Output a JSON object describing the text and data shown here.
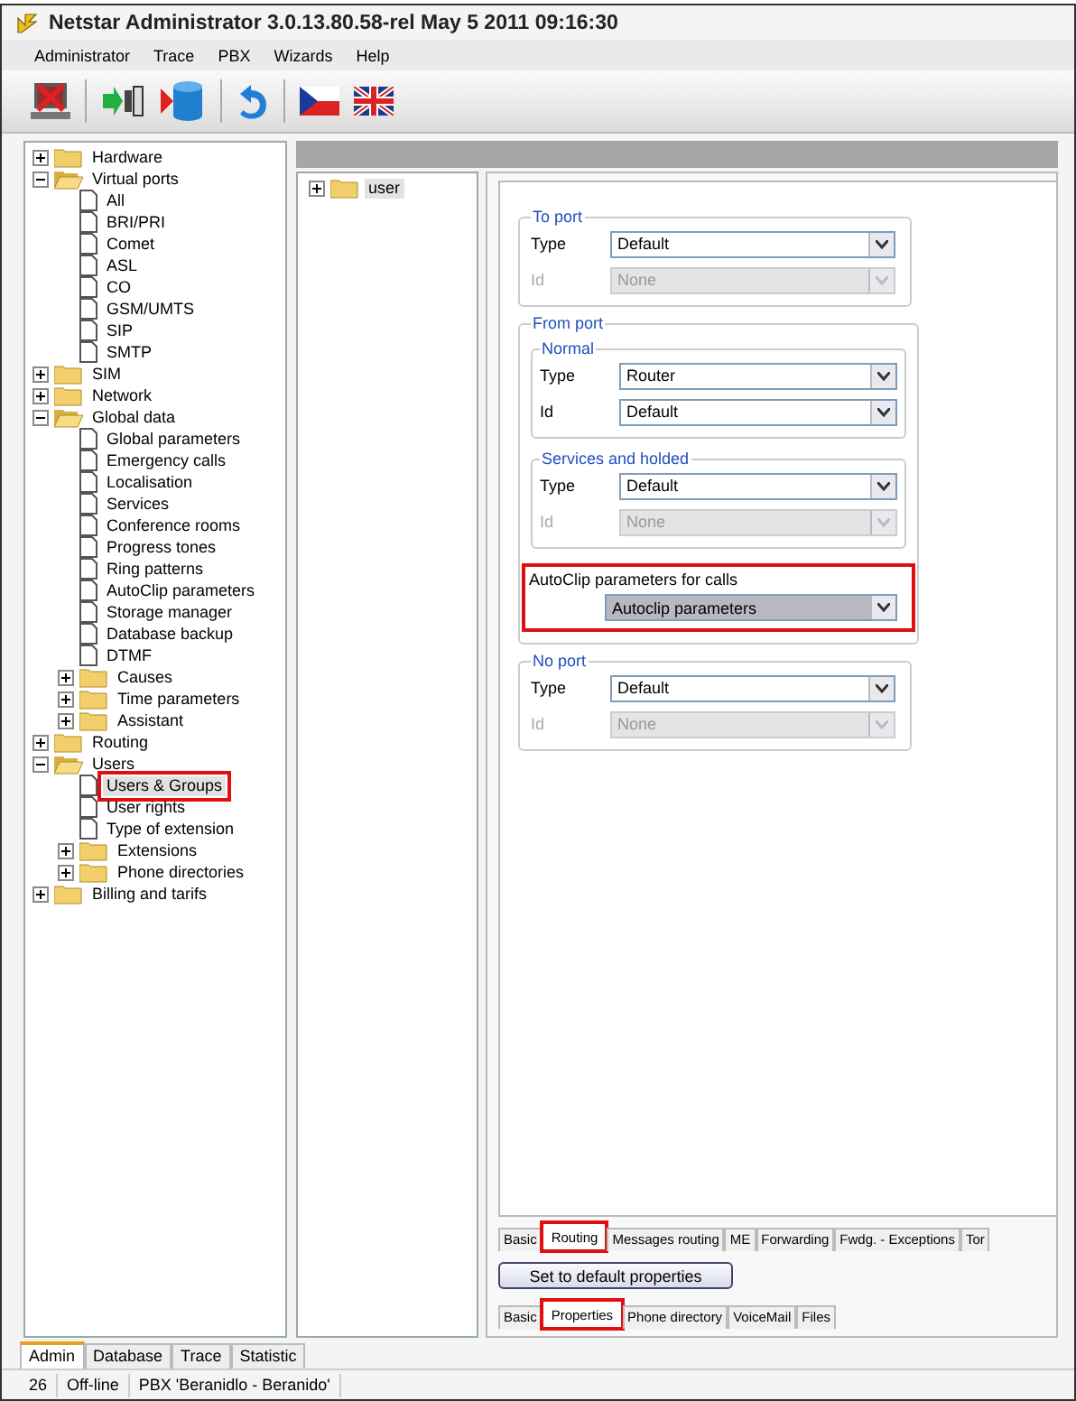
{
  "window": {
    "title": "Netstar Administrator 3.0.13.80.58-rel May  5 2011 09:16:30"
  },
  "menu": [
    "Administrator",
    "Trace",
    "PBX",
    "Wizards",
    "Help"
  ],
  "toolbar": [
    {
      "kind": "disconnect"
    },
    {
      "kind": "connect"
    },
    {
      "kind": "database"
    },
    {
      "kind": "undo"
    },
    {
      "kind": "flag_cz"
    },
    {
      "kind": "flag_uk"
    }
  ],
  "tree": [
    {
      "label": "Hardware",
      "kind": "folder",
      "expanded": false,
      "selected": false,
      "highlighted": false
    },
    {
      "label": "Virtual ports",
      "kind": "folder",
      "expanded": true,
      "selected": false,
      "highlighted": false,
      "children": [
        {
          "label": "All",
          "kind": "page",
          "selected": false,
          "highlighted": false
        },
        {
          "label": "BRI/PRI",
          "kind": "page",
          "selected": false,
          "highlighted": false
        },
        {
          "label": "Comet",
          "kind": "page",
          "selected": false,
          "highlighted": false
        },
        {
          "label": "ASL",
          "kind": "page",
          "selected": false,
          "highlighted": false
        },
        {
          "label": "CO",
          "kind": "page",
          "selected": false,
          "highlighted": false
        },
        {
          "label": "GSM/UMTS",
          "kind": "page",
          "selected": false,
          "highlighted": false
        },
        {
          "label": "SIP",
          "kind": "page",
          "selected": false,
          "highlighted": false
        },
        {
          "label": "SMTP",
          "kind": "page",
          "selected": false,
          "highlighted": false
        }
      ]
    },
    {
      "label": "SIM",
      "kind": "folder",
      "expanded": false,
      "selected": false,
      "highlighted": false
    },
    {
      "label": "Network",
      "kind": "folder",
      "expanded": false,
      "selected": false,
      "highlighted": false
    },
    {
      "label": "Global data",
      "kind": "folder",
      "expanded": true,
      "selected": false,
      "highlighted": false,
      "children": [
        {
          "label": "Global parameters",
          "kind": "page",
          "selected": false,
          "highlighted": false
        },
        {
          "label": "Emergency calls",
          "kind": "page",
          "selected": false,
          "highlighted": false
        },
        {
          "label": "Localisation",
          "kind": "page",
          "selected": false,
          "highlighted": false
        },
        {
          "label": "Services",
          "kind": "page",
          "selected": false,
          "highlighted": false
        },
        {
          "label": "Conference rooms",
          "kind": "page",
          "selected": false,
          "highlighted": false
        },
        {
          "label": "Progress tones",
          "kind": "page",
          "selected": false,
          "highlighted": false
        },
        {
          "label": "Ring patterns",
          "kind": "page",
          "selected": false,
          "highlighted": false
        },
        {
          "label": "AutoClip parameters",
          "kind": "page",
          "selected": false,
          "highlighted": false
        },
        {
          "label": "Storage manager",
          "kind": "page",
          "selected": false,
          "highlighted": false
        },
        {
          "label": "Database backup",
          "kind": "page",
          "selected": false,
          "highlighted": false
        },
        {
          "label": "DTMF",
          "kind": "page",
          "selected": false,
          "highlighted": false
        },
        {
          "label": "Causes",
          "kind": "folder",
          "expanded": false,
          "selected": false,
          "highlighted": false
        },
        {
          "label": "Time parameters",
          "kind": "folder",
          "expanded": false,
          "selected": false,
          "highlighted": false
        },
        {
          "label": "Assistant",
          "kind": "folder",
          "expanded": false,
          "selected": false,
          "highlighted": false
        }
      ]
    },
    {
      "label": "Routing",
      "kind": "folder",
      "expanded": false,
      "selected": false,
      "highlighted": false
    },
    {
      "label": "Users",
      "kind": "folder",
      "expanded": true,
      "selected": false,
      "highlighted": false,
      "children": [
        {
          "label": "Users & Groups",
          "kind": "page",
          "selected": true,
          "highlighted": true
        },
        {
          "label": "User rights",
          "kind": "page",
          "selected": false,
          "highlighted": false
        },
        {
          "label": "Type of extension",
          "kind": "page",
          "selected": false,
          "highlighted": false
        },
        {
          "label": "Extensions",
          "kind": "folder",
          "expanded": false,
          "selected": false,
          "highlighted": false
        },
        {
          "label": "Phone directories",
          "kind": "folder",
          "expanded": false,
          "selected": false,
          "highlighted": false
        }
      ]
    },
    {
      "label": "Billing and tarifs",
      "kind": "folder",
      "expanded": false,
      "selected": false,
      "highlighted": false
    }
  ],
  "user_tree": [
    {
      "label": "user",
      "kind": "folder",
      "expanded": false,
      "selected": true
    }
  ],
  "form": [
    {
      "kind": "group",
      "legend": "To port",
      "fields": [
        {
          "label": "Type",
          "value": "Default",
          "disabled": false
        },
        {
          "label": "Id",
          "value": "None",
          "disabled": true
        }
      ]
    },
    {
      "kind": "group",
      "legend": "From port",
      "subgroups": [
        {
          "legend": "Normal",
          "fields": [
            {
              "label": "Type",
              "value": "Router",
              "disabled": false
            },
            {
              "label": "Id",
              "value": "Default",
              "disabled": false
            }
          ]
        },
        {
          "legend": "Services and holded",
          "fields": [
            {
              "label": "Type",
              "value": "Default",
              "disabled": false
            },
            {
              "label": "Id",
              "value": "None",
              "disabled": true
            }
          ]
        }
      ],
      "extra": {
        "label": "AutoClip parameters for calls",
        "value": "Autoclip parameters",
        "highlighted": true
      }
    },
    {
      "kind": "group",
      "legend": "No port",
      "fields": [
        {
          "label": "Type",
          "value": "Default",
          "disabled": false
        },
        {
          "label": "Id",
          "value": "None",
          "disabled": true
        }
      ]
    }
  ],
  "inner_tabs": [
    {
      "label": "Basic",
      "selected": false,
      "highlighted": false
    },
    {
      "label": "Routing",
      "selected": true,
      "highlighted": true
    },
    {
      "label": "Messages routing",
      "selected": false,
      "highlighted": false
    },
    {
      "label": "ME",
      "selected": false,
      "highlighted": false
    },
    {
      "label": "Forwarding",
      "selected": false,
      "highlighted": false
    },
    {
      "label": "Fwdg. - Exceptions",
      "selected": false,
      "highlighted": false
    },
    {
      "label": "Tor",
      "selected": false,
      "highlighted": false
    }
  ],
  "default_button": "Set to default properties",
  "outer_tabs": [
    {
      "label": "Basic",
      "selected": false,
      "highlighted": false
    },
    {
      "label": "Properties",
      "selected": true,
      "highlighted": true
    },
    {
      "label": "Phone directory",
      "selected": false,
      "highlighted": false
    },
    {
      "label": "VoiceMail",
      "selected": false,
      "highlighted": false
    },
    {
      "label": "Files",
      "selected": false,
      "highlighted": false
    }
  ],
  "bottom_tabs": [
    {
      "label": "Admin",
      "selected": true
    },
    {
      "label": "Database",
      "selected": false
    },
    {
      "label": "Trace",
      "selected": false
    },
    {
      "label": "Statistic",
      "selected": false
    }
  ],
  "status_bar": [
    "26",
    "Off-line",
    "PBX 'Beranidlo - Beranido'"
  ]
}
